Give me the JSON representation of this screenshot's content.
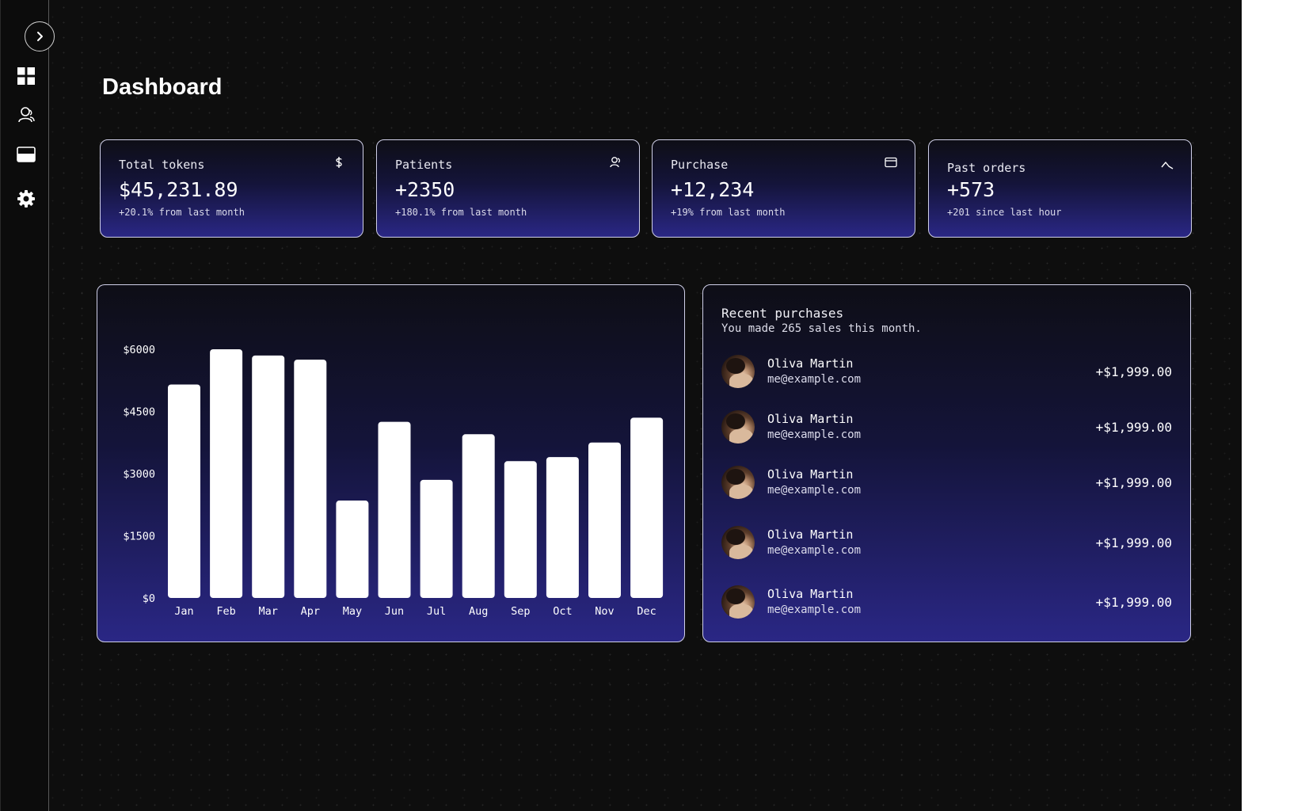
{
  "page": {
    "title": "Dashboard"
  },
  "sidebar": {
    "toggle_icon": "chevron-right-icon",
    "items": [
      {
        "icon": "dashboard-grid-icon"
      },
      {
        "icon": "users-icon"
      },
      {
        "icon": "card-icon"
      },
      {
        "icon": "gear-icon"
      }
    ]
  },
  "stats": [
    {
      "label": "Total tokens",
      "value": "$45,231.89",
      "sub": "+20.1% from last month",
      "icon": "dollar-icon"
    },
    {
      "label": "Patients",
      "value": "+2350",
      "sub": "+180.1% from last month",
      "icon": "users-icon"
    },
    {
      "label": "Purchase",
      "value": "+12,234",
      "sub": "+19% from last month",
      "icon": "card-icon"
    },
    {
      "label": "Past orders",
      "value": "+573",
      "sub": "+201 since last hour",
      "icon": "activity-icon"
    }
  ],
  "chart_data": {
    "type": "bar",
    "categories": [
      "Jan",
      "Feb",
      "Mar",
      "Apr",
      "May",
      "Jun",
      "Jul",
      "Aug",
      "Sep",
      "Oct",
      "Nov",
      "Dec"
    ],
    "values": [
      5150,
      6000,
      5850,
      5750,
      2350,
      4250,
      2850,
      3950,
      3300,
      3400,
      3750,
      4350
    ],
    "y_ticks": [
      "$0",
      "$1500",
      "$3000",
      "$4500",
      "$6000"
    ],
    "ylim": [
      0,
      6000
    ],
    "bar_color": "#ffffff",
    "grid": false
  },
  "recent": {
    "title": "Recent purchases",
    "description": "You made 265 sales this month.",
    "items": [
      {
        "name": "Oliva Martin",
        "email": "me@example.com",
        "amount": "+$1,999.00"
      },
      {
        "name": "Oliva Martin",
        "email": "me@example.com",
        "amount": "+$1,999.00"
      },
      {
        "name": "Oliva Martin",
        "email": "me@example.com",
        "amount": "+$1,999.00"
      },
      {
        "name": "Oliva Martin",
        "email": "me@example.com",
        "amount": "+$1,999.00"
      },
      {
        "name": "Oliva Martin",
        "email": "me@example.com",
        "amount": "+$1,999.00"
      }
    ]
  },
  "colors": {
    "background": "#0e0e0e",
    "card_gradient_end": "#2a2785",
    "border": "#cfcfe8"
  }
}
